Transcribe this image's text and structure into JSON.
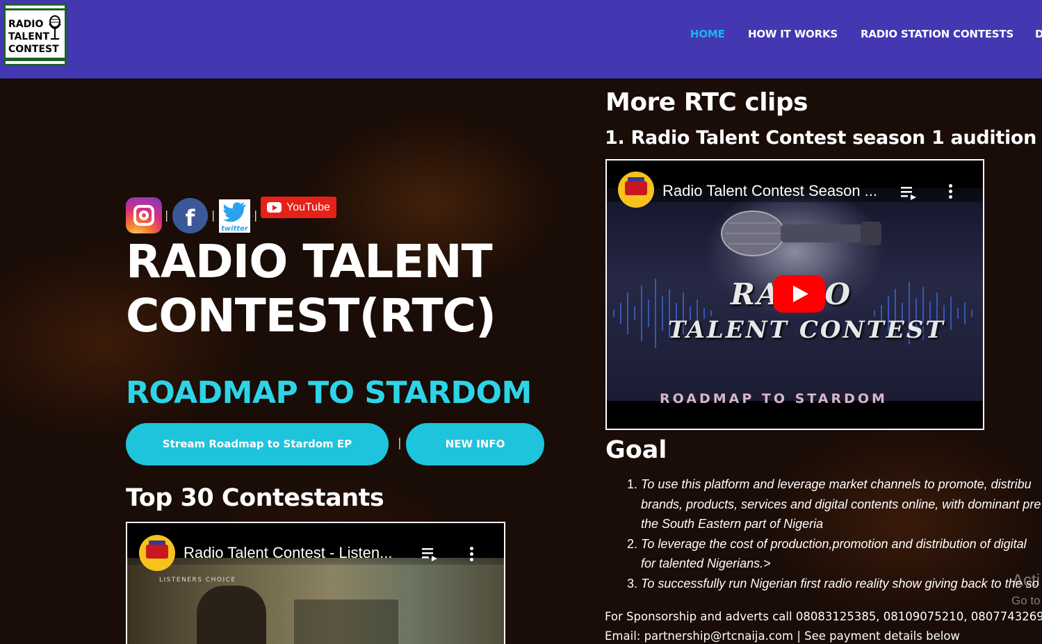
{
  "logo": {
    "lines": [
      "RADIO",
      "TALENT",
      "CONTEST"
    ]
  },
  "nav": {
    "items": [
      {
        "label": "HOME",
        "active": true
      },
      {
        "label": "HOW IT WORKS",
        "active": false
      },
      {
        "label": "RADIO STATION CONTESTS",
        "active": false
      },
      {
        "label": "D",
        "active": false
      }
    ]
  },
  "social": {
    "facebook_glyph": "f",
    "twitter_label": "twitter",
    "youtube_label": "YouTube",
    "separator": "|"
  },
  "hero": {
    "title_line1": "RADIO TALENT",
    "title_line2": "CONTEST(RTC)",
    "subtitle": "ROADMAP TO STARDOM",
    "button_stream": "Stream Roadmap to Stardom EP",
    "button_sep": "|",
    "button_info": "NEW INFO"
  },
  "top30": {
    "heading": "Top 30 Contestants",
    "video_title": "Radio Talent Contest - Listen...",
    "overlay_text": "LISTENERS CHOICE"
  },
  "clips": {
    "heading": "More RTC clips",
    "clip1_heading": "1. Radio Talent Contest season 1 audition",
    "video_title": "Radio Talent Contest Season ...",
    "thumb_line1": "RADIO",
    "thumb_line2": "TALENT CONTEST",
    "thumb_line3": "ROADMAP TO STARDOM"
  },
  "goal": {
    "heading": "Goal",
    "items": [
      {
        "num": "1.",
        "lines": [
          "To use this platform and leverage market channels to promote, distribu",
          "brands, products, services and digital contents online, with dominant pre",
          "the South Eastern part of Nigeria"
        ]
      },
      {
        "num": "2.",
        "lines": [
          "To leverage the cost of production,promotion and distribution of digital",
          "for talented Nigerians.>"
        ]
      },
      {
        "num": "3.",
        "lines": [
          "To successfully run Nigerian first radio reality show giving back to the so"
        ]
      }
    ]
  },
  "contact": {
    "phones": "For Sponsorship and adverts call 08083125385, 08109075210, 0807743269",
    "email": "Email: partnership@rtcnaija.com  |  See payment details below"
  },
  "windows_overlay": {
    "line1": "Acti",
    "line2": "Go to"
  },
  "colors": {
    "header_bg": "#4437b2",
    "nav_active": "#19b6ef",
    "accent_cyan": "#1ec3dc",
    "subtitle_cyan": "#2dd4e8",
    "youtube_red": "#e62117"
  }
}
